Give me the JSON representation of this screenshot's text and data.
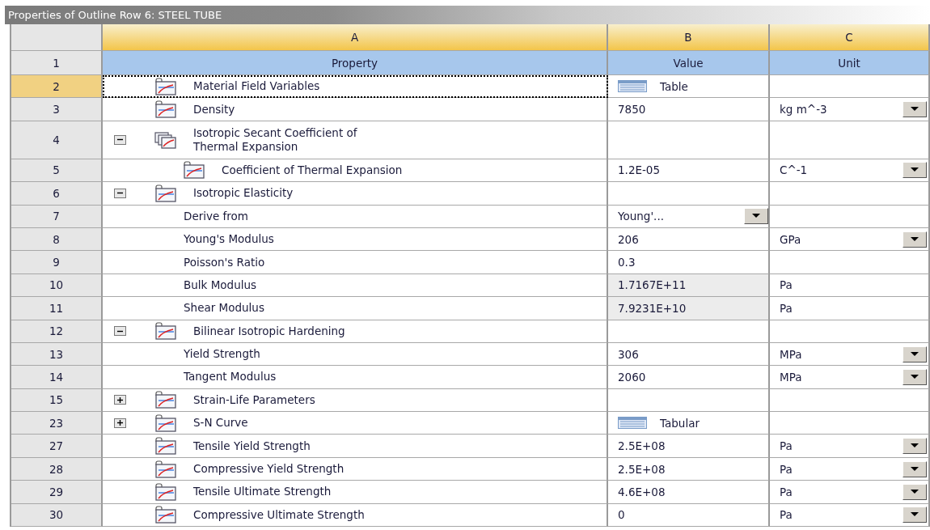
{
  "window": {
    "title": "Properties of Outline Row 6: STEEL TUBE"
  },
  "table": {
    "columns": [
      "A",
      "B",
      "C"
    ],
    "header_row": {
      "number": "1",
      "cells": [
        "Property",
        "Value",
        "Unit"
      ]
    },
    "rows": [
      {
        "number": "2",
        "property": "Material Field Variables",
        "kind": "curve",
        "selected": true,
        "value": {
          "kind": "table",
          "text": "Table"
        }
      },
      {
        "number": "3",
        "property": "Density",
        "kind": "curve",
        "selected": false,
        "value": {
          "kind": "text",
          "text": "7850"
        },
        "unit": {
          "kind": "dropdown",
          "text": "kg m^-3"
        }
      },
      {
        "number": "4",
        "property": "Isotropic Secant Coefficient of\nThermal Expansion",
        "kind": "curve-group",
        "expanded": true,
        "selected": false,
        "children": [
          {
            "number": "5",
            "property": "Coefficient of Thermal Expansion",
            "kind": "curve",
            "selected": false,
            "value": {
              "kind": "text",
              "text": "1.2E-05"
            },
            "unit": {
              "kind": "dropdown",
              "text": "C^-1"
            }
          }
        ]
      },
      {
        "number": "6",
        "property": "Isotropic Elasticity",
        "kind": "curve",
        "expanded": true,
        "selected": false,
        "children": [
          {
            "number": "7",
            "property": "Derive from",
            "kind": "plain",
            "selected": false,
            "value": {
              "kind": "dropdown",
              "text": "Young'..."
            }
          },
          {
            "number": "8",
            "property": "Young's Modulus",
            "kind": "plain",
            "selected": false,
            "value": {
              "kind": "text",
              "text": "206"
            },
            "unit": {
              "kind": "dropdown",
              "text": "GPa"
            }
          },
          {
            "number": "9",
            "property": "Poisson's Ratio",
            "kind": "plain",
            "selected": false,
            "value": {
              "kind": "text",
              "text": "0.3"
            }
          },
          {
            "number": "10",
            "property": "Bulk Modulus",
            "kind": "plain",
            "selected": false,
            "value": {
              "kind": "text",
              "text": "1.7167E+11",
              "read_only": true
            },
            "unit": {
              "kind": "text",
              "text": "Pa"
            }
          },
          {
            "number": "11",
            "property": "Shear Modulus",
            "kind": "plain",
            "selected": false,
            "value": {
              "kind": "text",
              "text": "7.9231E+10",
              "read_only": true
            },
            "unit": {
              "kind": "text",
              "text": "Pa"
            }
          }
        ]
      },
      {
        "number": "12",
        "property": "Bilinear Isotropic Hardening",
        "kind": "curve",
        "expanded": true,
        "selected": false,
        "children": [
          {
            "number": "13",
            "property": "Yield Strength",
            "kind": "plain",
            "selected": false,
            "value": {
              "kind": "text",
              "text": "306"
            },
            "unit": {
              "kind": "dropdown",
              "text": "MPa"
            }
          },
          {
            "number": "14",
            "property": "Tangent Modulus",
            "kind": "plain",
            "selected": false,
            "value": {
              "kind": "text",
              "text": "2060"
            },
            "unit": {
              "kind": "dropdown",
              "text": "MPa"
            }
          }
        ]
      },
      {
        "number": "15",
        "property": "Strain-Life Parameters",
        "kind": "curve",
        "expanded": false,
        "selected": false
      },
      {
        "number": "23",
        "property": "S-N Curve",
        "kind": "curve",
        "expanded": false,
        "selected": false,
        "value": {
          "kind": "table",
          "text": "Tabular"
        }
      },
      {
        "number": "27",
        "property": "Tensile Yield Strength",
        "kind": "curve",
        "selected": false,
        "value": {
          "kind": "text",
          "text": "2.5E+08"
        },
        "unit": {
          "kind": "dropdown",
          "text": "Pa"
        }
      },
      {
        "number": "28",
        "property": "Compressive Yield Strength",
        "kind": "curve",
        "selected": false,
        "value": {
          "kind": "text",
          "text": "2.5E+08"
        },
        "unit": {
          "kind": "dropdown",
          "text": "Pa"
        }
      },
      {
        "number": "29",
        "property": "Tensile Ultimate Strength",
        "kind": "curve",
        "selected": false,
        "value": {
          "kind": "text",
          "text": "4.6E+08"
        },
        "unit": {
          "kind": "dropdown",
          "text": "Pa"
        }
      },
      {
        "number": "30",
        "property": "Compressive Ultimate Strength",
        "kind": "curve",
        "selected": false,
        "value": {
          "kind": "text",
          "text": "0"
        },
        "unit": {
          "kind": "dropdown",
          "text": "Pa"
        }
      }
    ]
  }
}
